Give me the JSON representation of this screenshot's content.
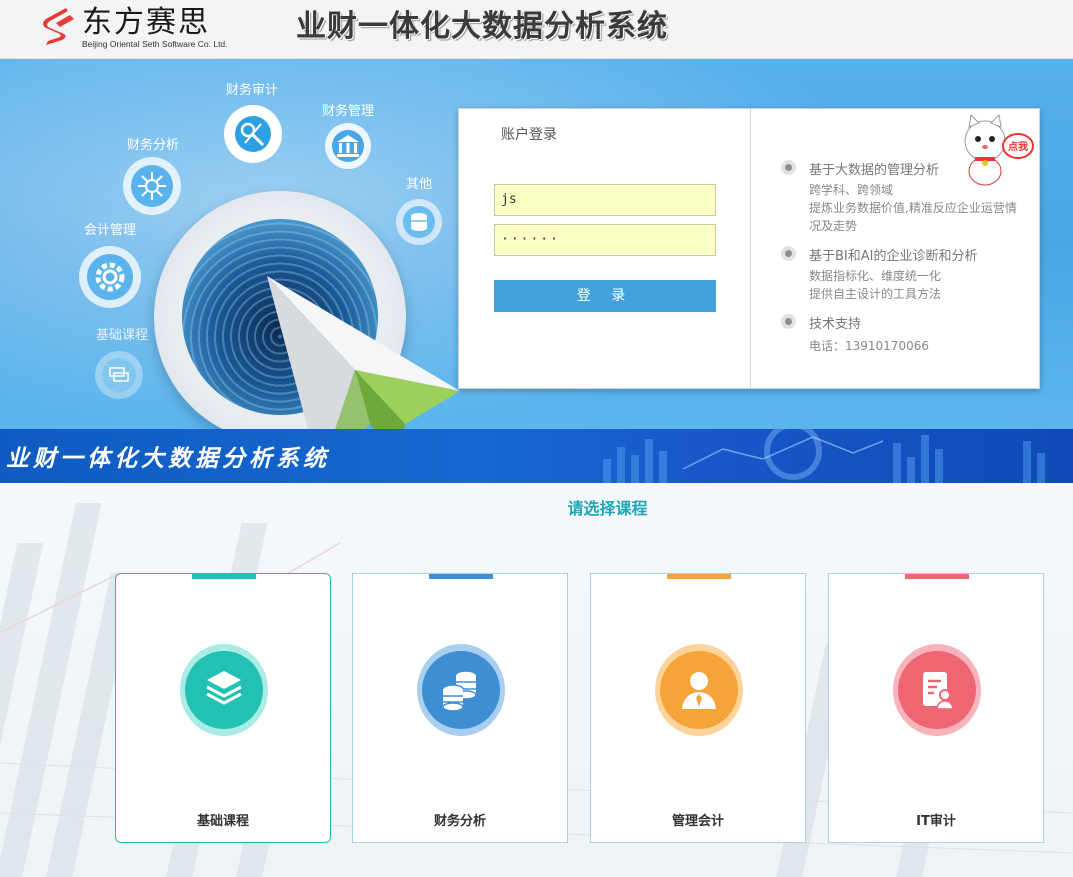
{
  "header": {
    "company_cn": "东方赛思",
    "company_en": "Beijing Oriental Seth Software Co. Ltd.",
    "system_title": "业财一体化大数据分析系统"
  },
  "banner": {
    "orbits": [
      {
        "label": "财务审计",
        "icon": "audit-tools-icon"
      },
      {
        "label": "财务管理",
        "icon": "bank-icon"
      },
      {
        "label": "财务分析",
        "icon": "burst-icon"
      },
      {
        "label": "其他",
        "icon": "database-icon"
      },
      {
        "label": "会计管理",
        "icon": "gear-icon"
      },
      {
        "label": "基础课程",
        "icon": "stack-icon"
      }
    ]
  },
  "login": {
    "title": "账户登录",
    "username_value": "js",
    "password_mask": "······",
    "button_label": "登 录"
  },
  "features": [
    {
      "title": "基于大数据的管理分析",
      "lines": [
        "跨学科、跨领域",
        "提炼业务数据价值,精准反应企业运营情",
        "况及走势"
      ]
    },
    {
      "title": "基于BI和AI的企业诊断和分析",
      "lines": [
        "数据指标化、维度统一化",
        "提供自主设计的工具方法"
      ]
    },
    {
      "title": "技术支持",
      "lines": [
        "电话：13910170066"
      ]
    }
  ],
  "mascot": {
    "badge": "点我"
  },
  "strip": {
    "title": "业财一体化大数据分析系统"
  },
  "courses": {
    "section_title": "请选择课程",
    "items": [
      {
        "label": "基础课程",
        "color": "#22c1b3",
        "ring": "#a9ebe5",
        "icon": "layers-icon"
      },
      {
        "label": "财务分析",
        "color": "#3f8ed4",
        "ring": "#a9cff0",
        "icon": "database-icon"
      },
      {
        "label": "管理会计",
        "color": "#f5a43a",
        "ring": "#fcd49a",
        "icon": "person-icon"
      },
      {
        "label": "IT审计",
        "color": "#ef6673",
        "ring": "#f9b3ba",
        "icon": "document-user-icon"
      }
    ]
  },
  "colors": {
    "accent": "#43a2dd",
    "teal": "#1fa6b8"
  }
}
